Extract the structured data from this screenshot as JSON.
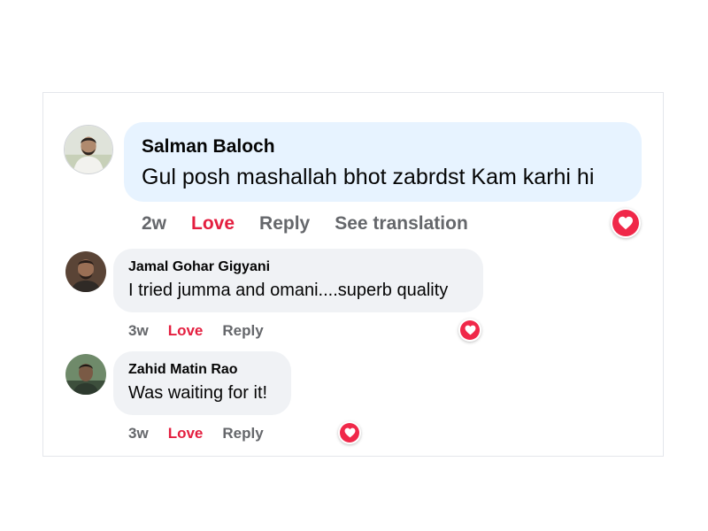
{
  "colors": {
    "love": "#e41e3f",
    "main_bubble": "#e7f3ff",
    "reply_bubble": "#f0f2f5",
    "action_text": "#65676b",
    "reaction": "#f02849"
  },
  "comments": [
    {
      "author": "Salman Baloch",
      "text": "Gul posh mashallah bhot zabrdst Kam karhi hi",
      "time": "2w",
      "love_label": "Love",
      "reply_label": "Reply",
      "translate_label": "See translation",
      "reaction_icon": "heart-icon"
    },
    {
      "author": "Jamal Gohar Gigyani",
      "text": "I tried jumma and omani....superb quality",
      "time": "3w",
      "love_label": "Love",
      "reply_label": "Reply",
      "reaction_icon": "heart-icon"
    },
    {
      "author": "Zahid Matin Rao",
      "text": "Was waiting for it!",
      "time": "3w",
      "love_label": "Love",
      "reply_label": "Reply",
      "reaction_icon": "heart-icon"
    }
  ]
}
